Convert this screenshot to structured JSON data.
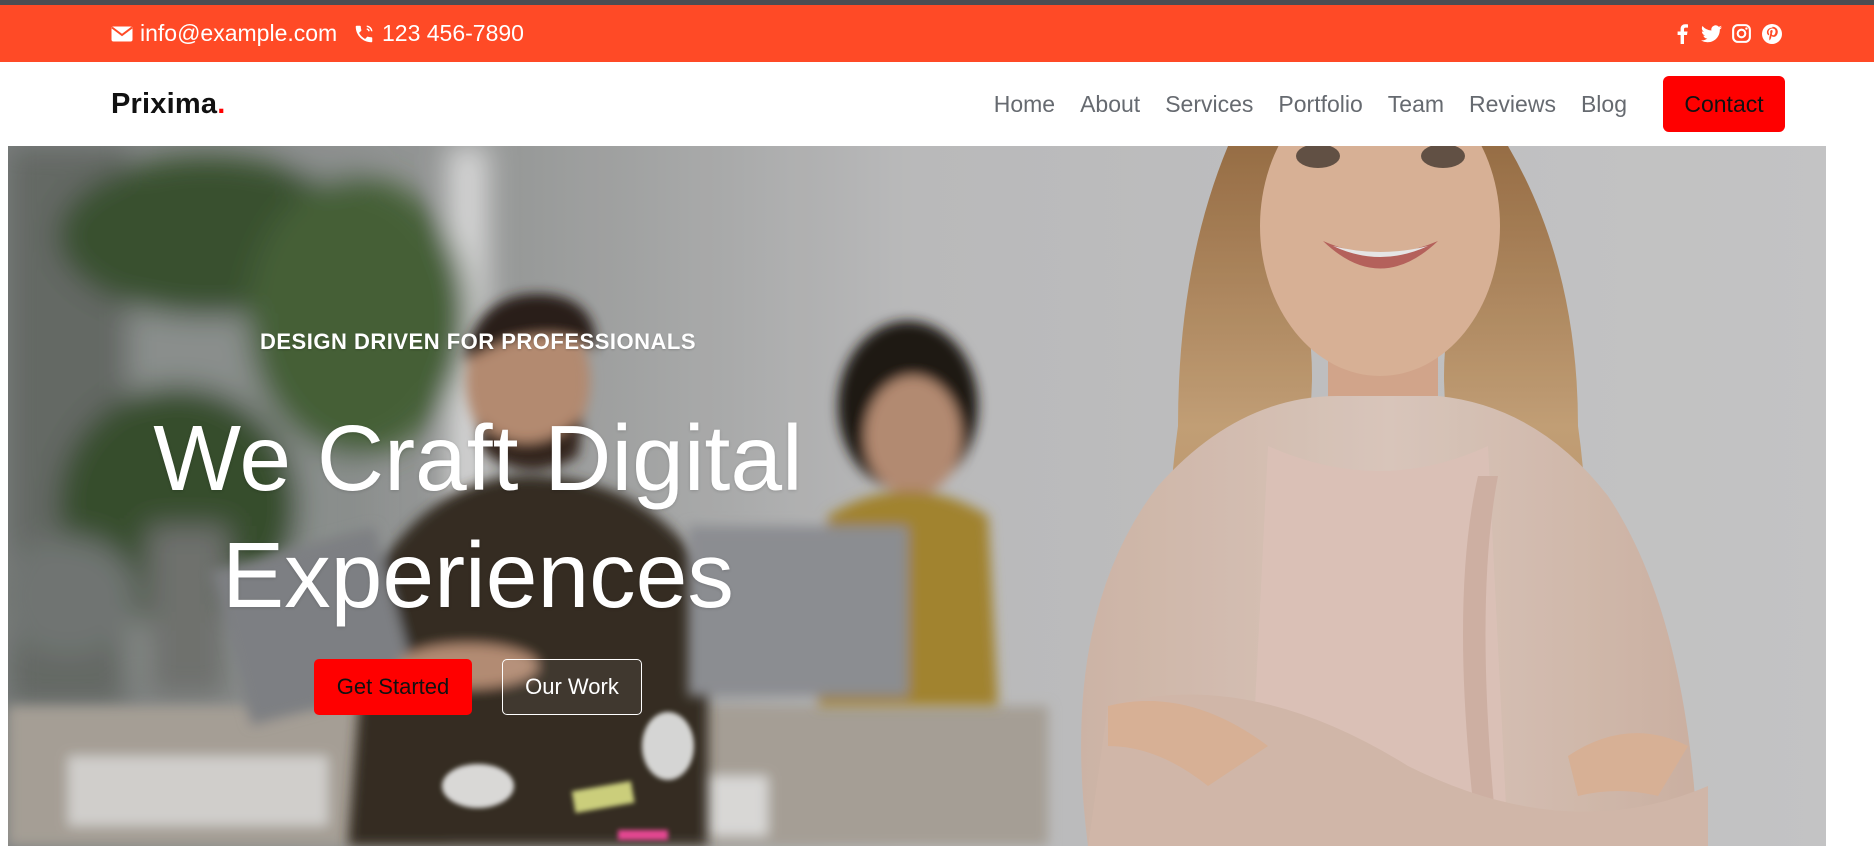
{
  "topbar": {
    "email": "info@example.com",
    "phone": "123 456-7890",
    "social_icons": [
      "facebook-icon",
      "twitter-icon",
      "instagram-icon",
      "pinterest-icon"
    ]
  },
  "header": {
    "logo_text": "Prixima",
    "logo_dot": ".",
    "nav": [
      "Home",
      "About",
      "Services",
      "Portfolio",
      "Team",
      "Reviews",
      "Blog"
    ],
    "contact_label": "Contact"
  },
  "hero": {
    "eyebrow": "DESIGN DRIVEN FOR PROFESSIONALS",
    "headline_line1": "We Craft Digital",
    "headline_line2": "Experiences",
    "primary_cta": "Get Started",
    "secondary_cta": "Our Work"
  },
  "colors": {
    "topbar": "#ff4a26",
    "accent": "#ff0000",
    "nav_text": "#666a70",
    "logo_text": "#111111"
  }
}
